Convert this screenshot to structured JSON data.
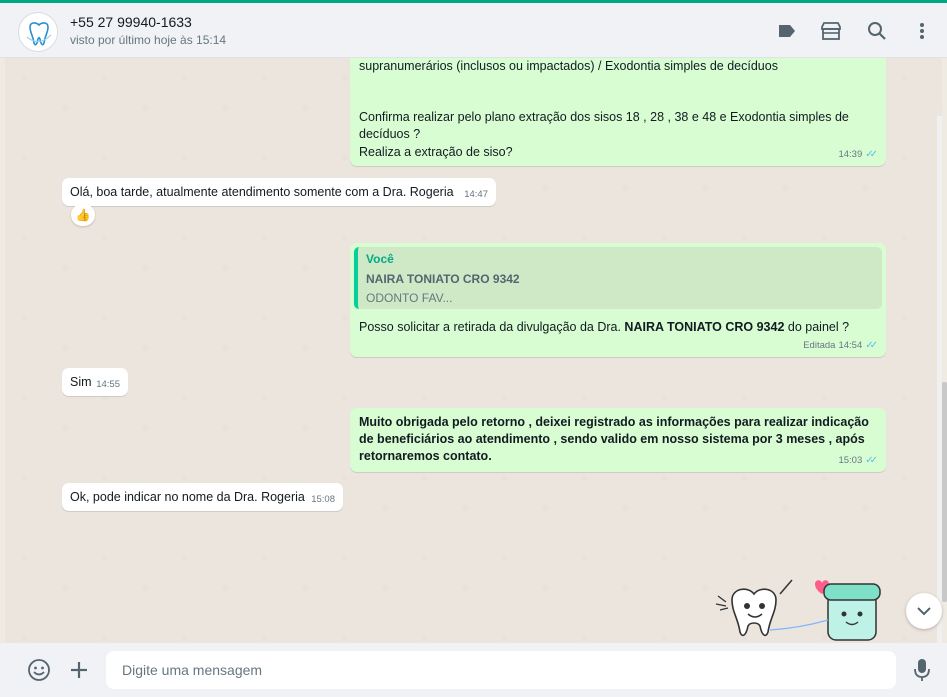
{
  "header": {
    "contact_name": "+55 27 99940-1633",
    "contact_status": "visto por último hoje às 15:14",
    "icons": [
      "label-icon",
      "store-icon",
      "search-icon",
      "menu-icon"
    ]
  },
  "messages": {
    "m1": {
      "line1": "supranumerários (inclusos ou impactados) /  Exodontia simples de decíduos",
      "line2": "Confirma realizar pelo plano  extração dos sisos 18 , 28 , 38 e 48 e Exodontia simples de decíduos ?",
      "line3": "Realiza a extração de siso?",
      "time": "14:39"
    },
    "m2": {
      "text": "Olá, boa tarde, atualmente atendimento somente com a Dra. Rogeria",
      "time": "14:47",
      "reaction": "👍"
    },
    "m3": {
      "quote_author": "Você",
      "quote_title": "NAIRA TONIATO CRO 9342",
      "quote_sub": "ODONTO FAV...",
      "text_before": "Posso solicitar a retirada da divulgação da Dra. ",
      "text_bold": "NAIRA TONIATO CRO 9342",
      "text_after": " do painel ?",
      "edited_label": "Editada",
      "time": "14:54"
    },
    "m4": {
      "text": "Sim",
      "time": "14:55"
    },
    "m5": {
      "text": "Muito obrigada pelo retorno , deixei registrado as informações para realizar indicação de beneficiários ao atendimento , sendo valido em nosso sistema por 3 meses , após retornaremos contato.",
      "time": "15:03"
    },
    "m6": {
      "text": "Ok, pode indicar no nome da Dra. Rogeria",
      "time": "15:08"
    }
  },
  "footer": {
    "placeholder": "Digite uma mensagem",
    "icons": [
      "emoji-icon",
      "plus-icon",
      "microphone-icon"
    ]
  },
  "colors": {
    "accent": "#00a884",
    "outgoing_bubble": "#d9fdd3",
    "incoming_bubble": "#ffffff",
    "read_ticks": "#53bdeb"
  }
}
